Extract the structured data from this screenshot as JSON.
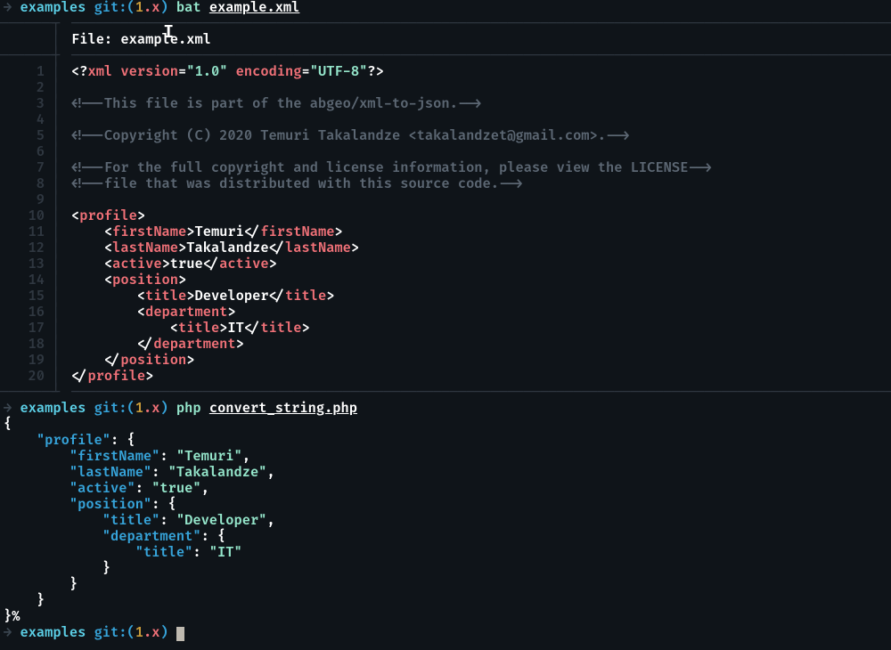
{
  "prompt1": {
    "arrow": "→",
    "dir": "examples",
    "git": "git:",
    "paren_open": "(",
    "branch_num": "1",
    "branch_dot": ".",
    "branch_suf": "x",
    "paren_close": ")",
    "cmd": "bat",
    "arg": "example.xml"
  },
  "bat_header": {
    "file_label": "File:",
    "file_name": "example.xml"
  },
  "xml": {
    "line1": {
      "open": "<?",
      "kw1": "xml",
      "sp": " ",
      "kw2": "version",
      "eq": "=",
      "str1": "\"1.0\"",
      "sp2": " ",
      "kw3": "encoding",
      "eq2": "=",
      "str2": "\"UTF-8\"",
      "close": "?>"
    },
    "line3": "<!--This file is part of the abgeo/xml-to-json.-->",
    "line5": "<!--Copyright (C) 2020 Temuri Takalandze <takalandzet@gmail.com>.-->",
    "line7": "<!--For the full copyright and license information, please view the LICENSE-->",
    "line8": "<!--file that was distributed with this source code.-->",
    "l10": {
      "o": "<",
      "t": "profile",
      "c": ">"
    },
    "l11": {
      "pad": "    ",
      "o": "<",
      "t": "firstName",
      "c": ">",
      "tx": "Temuri",
      "o2": "</",
      "t2": "firstName",
      "c2": ">"
    },
    "l12": {
      "pad": "    ",
      "o": "<",
      "t": "lastName",
      "c": ">",
      "tx": "Takalandze",
      "o2": "</",
      "t2": "lastName",
      "c2": ">"
    },
    "l13": {
      "pad": "    ",
      "o": "<",
      "t": "active",
      "c": ">",
      "tx": "true",
      "o2": "</",
      "t2": "active",
      "c2": ">"
    },
    "l14": {
      "pad": "    ",
      "o": "<",
      "t": "position",
      "c": ">"
    },
    "l15": {
      "pad": "        ",
      "o": "<",
      "t": "title",
      "c": ">",
      "tx": "Developer",
      "o2": "</",
      "t2": "title",
      "c2": ">"
    },
    "l16": {
      "pad": "        ",
      "o": "<",
      "t": "department",
      "c": ">"
    },
    "l17": {
      "pad": "            ",
      "o": "<",
      "t": "title",
      "c": ">",
      "tx": "IT",
      "o2": "</",
      "t2": "title",
      "c2": ">"
    },
    "l18": {
      "pad": "        ",
      "o": "</",
      "t": "department",
      "c": ">"
    },
    "l19": {
      "pad": "    ",
      "o": "</",
      "t": "position",
      "c": ">"
    },
    "l20": {
      "o": "</",
      "t": "profile",
      "c": ">"
    }
  },
  "linenos": [
    "1",
    "2",
    "3",
    "4",
    "5",
    "6",
    "7",
    "8",
    "9",
    "10",
    "11",
    "12",
    "13",
    "14",
    "15",
    "16",
    "17",
    "18",
    "19",
    "20"
  ],
  "prompt2": {
    "arrow": "→",
    "dir": "examples",
    "git": "git:",
    "paren_open": "(",
    "branch_num": "1",
    "branch_dot": ".",
    "branch_suf": "x",
    "paren_close": ")",
    "cmd": "php",
    "arg": "convert_string.php"
  },
  "json_out": {
    "l0": "{",
    "l1_pad": "    ",
    "l1_k": "\"profile\"",
    "l1_r": ": {",
    "l2_pad": "        ",
    "l2_k": "\"firstName\"",
    "l2_c": ": ",
    "l2_v": "\"Temuri\"",
    "l2_e": ",",
    "l3_pad": "        ",
    "l3_k": "\"lastName\"",
    "l3_c": ": ",
    "l3_v": "\"Takalandze\"",
    "l3_e": ",",
    "l4_pad": "        ",
    "l4_k": "\"active\"",
    "l4_c": ": ",
    "l4_v": "\"true\"",
    "l4_e": ",",
    "l5_pad": "        ",
    "l5_k": "\"position\"",
    "l5_c": ": {",
    "l6_pad": "            ",
    "l6_k": "\"title\"",
    "l6_c": ": ",
    "l6_v": "\"Developer\"",
    "l6_e": ",",
    "l7_pad": "            ",
    "l7_k": "\"department\"",
    "l7_c": ": {",
    "l8_pad": "                ",
    "l8_k": "\"title\"",
    "l8_c": ": ",
    "l8_v": "\"IT\"",
    "l9": "            }",
    "l10": "        }",
    "l11": "    }",
    "l12": "}%"
  },
  "prompt3": {
    "arrow": "→",
    "dir": "examples",
    "git": "git:",
    "paren_open": "(",
    "branch_num": "1",
    "branch_dot": ".",
    "branch_suf": "x",
    "paren_close": ")"
  }
}
